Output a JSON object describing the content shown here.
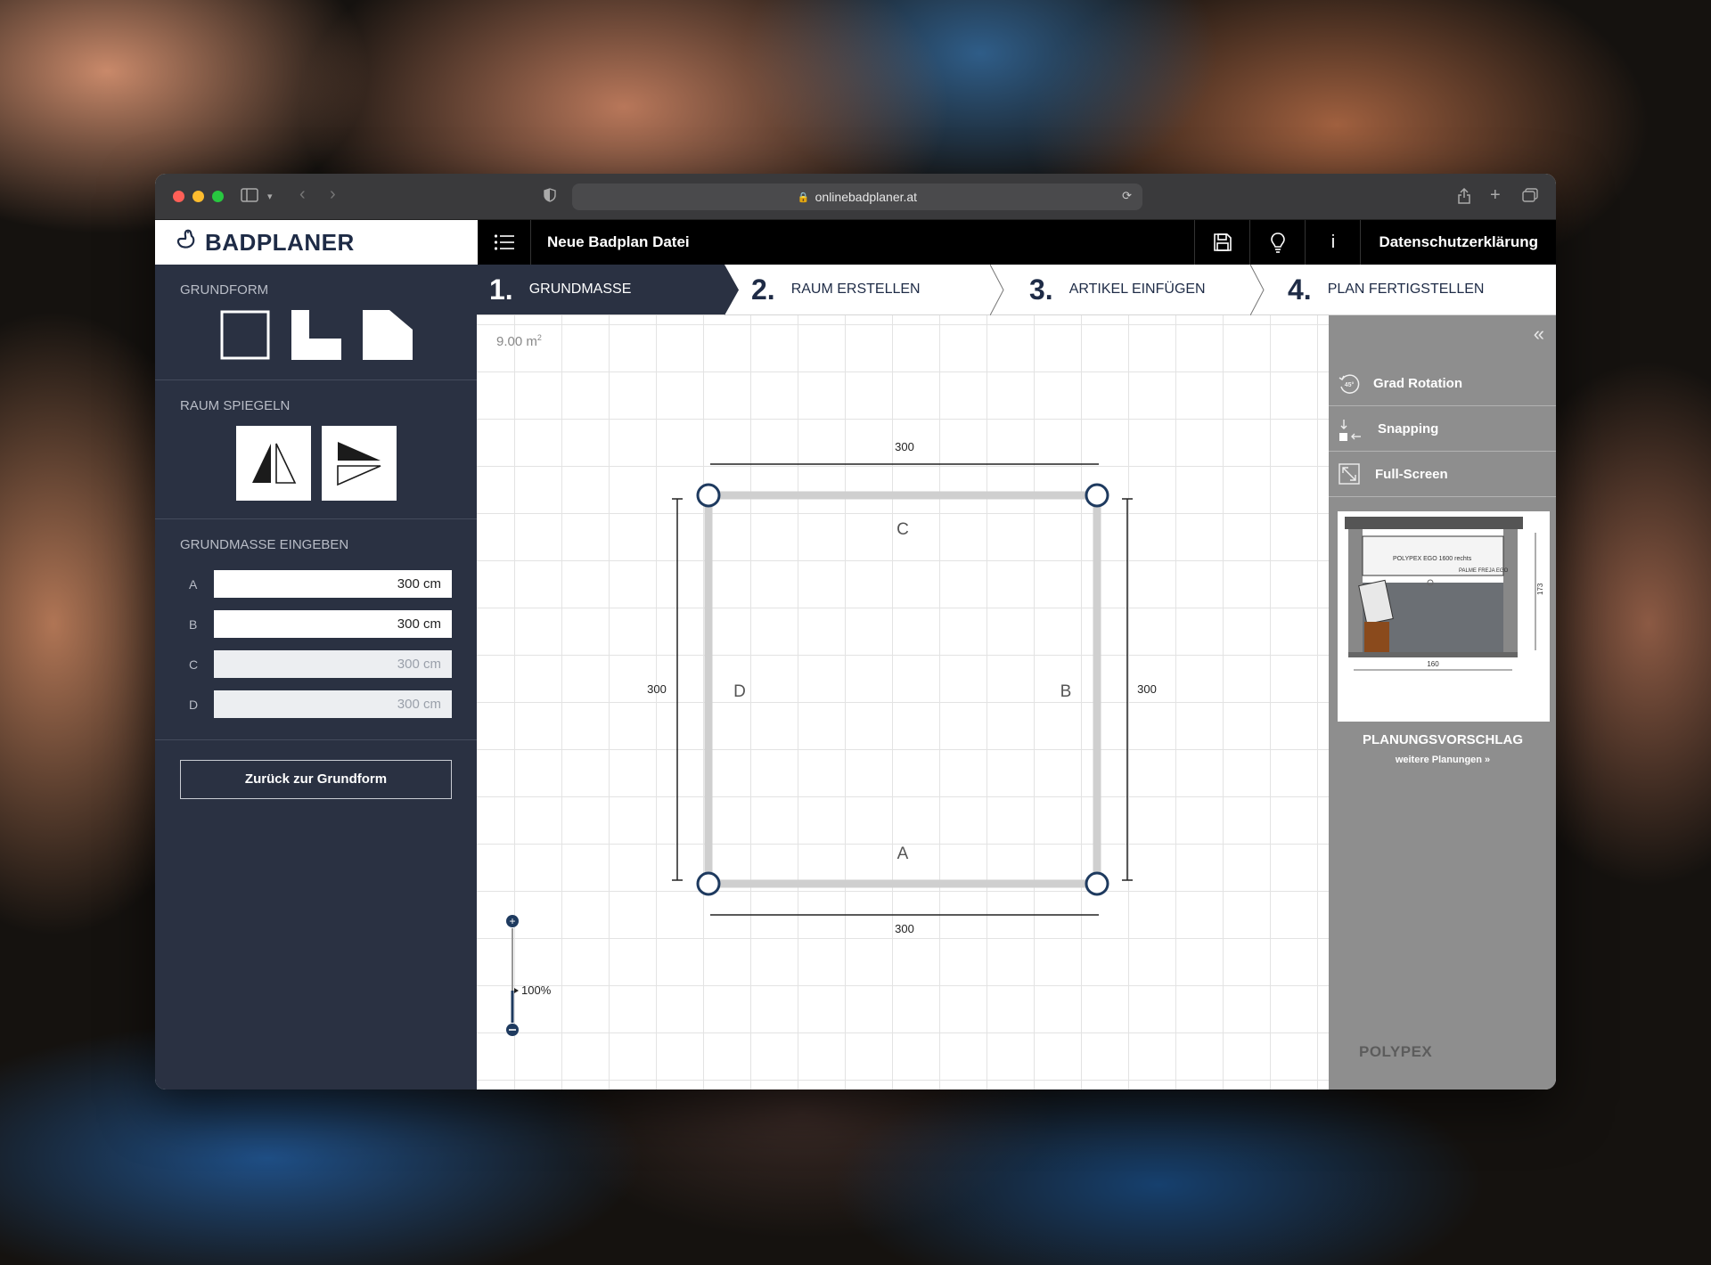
{
  "browser": {
    "url": "onlinebadplaner.at"
  },
  "header": {
    "brand": "BADPLANER",
    "file_title": "Neue Badplan Datei",
    "privacy_label": "Datenschutzerklärung",
    "info_label": "i"
  },
  "steps": [
    {
      "num": "1.",
      "label": "GRUNDMASSE",
      "active": true
    },
    {
      "num": "2.",
      "label": "RAUM ERSTELLEN",
      "active": false
    },
    {
      "num": "3.",
      "label": "ARTIKEL EINFÜGEN",
      "active": false
    },
    {
      "num": "4.",
      "label": "PLAN FERTIGSTELLEN",
      "active": false
    }
  ],
  "sidebar": {
    "grundform_title": "GRUNDFORM",
    "spiegeln_title": "RAUM SPIEGELN",
    "eingeben_title": "GRUNDMASSE EINGEBEN",
    "dimensions": [
      {
        "label": "A",
        "value": "300  cm",
        "disabled": false
      },
      {
        "label": "B",
        "value": "300  cm",
        "disabled": false
      },
      {
        "label": "C",
        "value": "300  cm",
        "disabled": true
      },
      {
        "label": "D",
        "value": "300  cm",
        "disabled": true
      }
    ],
    "back_button": "Zurück zur Grundform"
  },
  "canvas": {
    "area": "9.00 m",
    "area_sup": "2",
    "zoom_label": "100%",
    "room": {
      "top_dim": "300",
      "bottom_dim": "300",
      "left_dim": "300",
      "right_dim": "300",
      "wall_a": "A",
      "wall_b": "B",
      "wall_c": "C",
      "wall_d": "D"
    }
  },
  "right_panel": {
    "items": [
      {
        "label": "Grad Rotation",
        "icon": "rotation-45-icon"
      },
      {
        "label": "Snapping",
        "icon": "snapping-icon"
      },
      {
        "label": "Full-Screen",
        "icon": "fullscreen-icon"
      }
    ],
    "rotation_badge": "45°",
    "suggest_title": "PLANUNGSVORSCHLAG",
    "suggest_link": "weitere Planungen »",
    "brand_logo": "POLYPEX",
    "thumbnail": {
      "label_top": "POLYPEX EGO 1600 rechts",
      "label_right": "PALME\nFREJA\nEGO",
      "dim_bottom": "160",
      "dim_right": "173"
    }
  }
}
